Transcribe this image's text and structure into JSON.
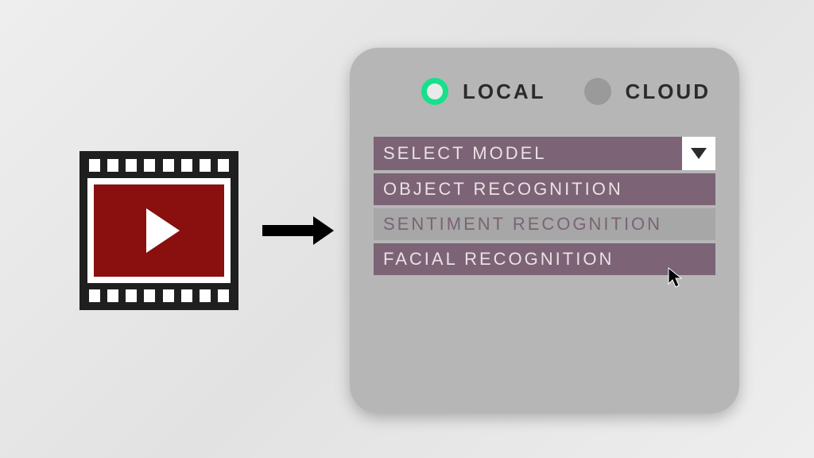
{
  "deployment": {
    "local_label": "LOCAL",
    "cloud_label": "CLOUD",
    "selected": "local"
  },
  "select": {
    "placeholder": "SELECT MODEL",
    "options": [
      {
        "label": "OBJECT RECOGNITION"
      },
      {
        "label": "SENTIMENT RECOGNITION"
      },
      {
        "label": "FACIAL RECOGNITION"
      }
    ],
    "hovered_index": 1
  },
  "colors": {
    "accent": "#16e08a",
    "panel": "#b6b6b6",
    "option_bg": "#7c6375",
    "video_red": "#8a0f0f"
  }
}
